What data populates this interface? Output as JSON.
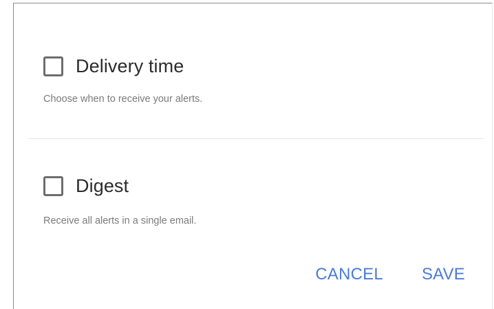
{
  "options": [
    {
      "title": "Delivery time",
      "description": "Choose when to receive your alerts.",
      "checked": false
    },
    {
      "title": "Digest",
      "description": "Receive all alerts in a single email.",
      "checked": false
    }
  ],
  "actions": {
    "cancel_label": "CANCEL",
    "save_label": "SAVE"
  },
  "colors": {
    "accent": "#4a7bd8",
    "title_text": "#2b2b2b",
    "description_text": "#7a7a7a",
    "checkbox_border": "#6d6d6d"
  },
  "icons": {
    "checkbox": "checkbox-unchecked-icon"
  }
}
